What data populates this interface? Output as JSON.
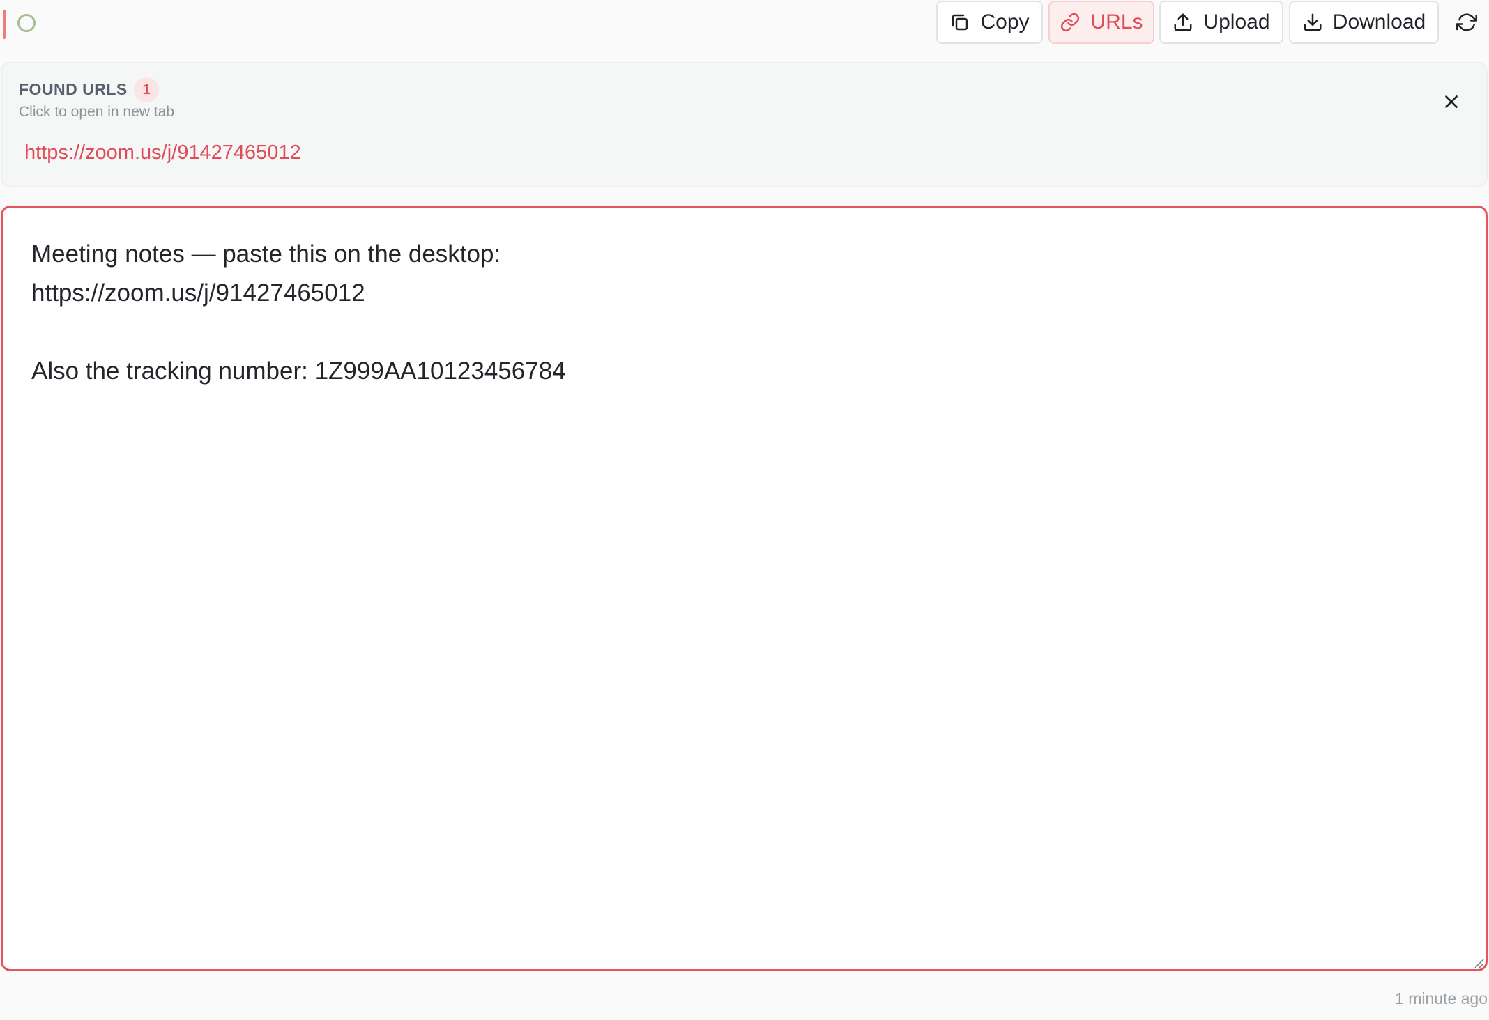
{
  "toolbar": {
    "copy_label": "Copy",
    "urls_label": "URLs",
    "upload_label": "Upload",
    "download_label": "Download",
    "refresh_icon": "refresh-icon",
    "status_icon": "circle-icon"
  },
  "url_panel": {
    "title": "FOUND URLS",
    "count": "1",
    "subtitle": "Click to open in new tab",
    "urls": [
      "https://zoom.us/j/91427465012"
    ]
  },
  "editor": {
    "content": "Meeting notes — paste this on the desktop:\nhttps://zoom.us/j/91427465012\n\nAlso the tracking number: 1Z999AA10123456784"
  },
  "footer": {
    "timestamp": "1 minute ago"
  },
  "colors": {
    "accent": "#e14b56",
    "accent_bar": "#f07a82",
    "status_ring": "#a7be95"
  }
}
